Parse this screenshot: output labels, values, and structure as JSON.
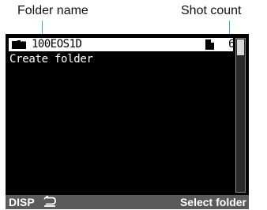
{
  "callouts": {
    "folder_name": "Folder name",
    "shot_count": "Shot count"
  },
  "folder_list": {
    "selected": {
      "icon": "folder-icon",
      "name": "100EOS1D",
      "count_icon": "file-icon",
      "count": "6"
    },
    "create_folder_label": "Create folder"
  },
  "bottom_bar": {
    "disp_label": "DISP",
    "return_icon": "return-arrow-icon",
    "action_label": "Select folder"
  },
  "colors": {
    "screen_bg": "#000000",
    "highlight_bg": "#ffffff",
    "bottom_bar_bg": "#5a5a5a",
    "leader_line": "#4aa3df"
  }
}
